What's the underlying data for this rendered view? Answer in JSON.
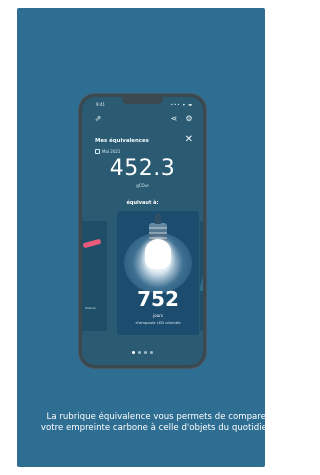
{
  "caption": "La rubrique équivalence vous permets de comparer votre empreinte carbone à celle d'objets du quotidien.",
  "phone": {
    "status_time": "9:41",
    "status_icons": "••• ▾ ▬",
    "panel_title": "Mes équivalences",
    "date": "Mai 2021",
    "value": "452.3",
    "unit": "gCO₂e",
    "equiv_label": "équivaut à:",
    "tile": {
      "number": "752",
      "unit": "jours",
      "subtitle": "d'ampoule LED allumée"
    },
    "side_left_tiny": "Voiture",
    "pager": {
      "count": 4,
      "active": 0
    }
  },
  "colors": {
    "card": "#2f6e93",
    "screen": "#2a5b73",
    "tile": "#1c4d6e",
    "accent_pink": "#e85b7a"
  }
}
